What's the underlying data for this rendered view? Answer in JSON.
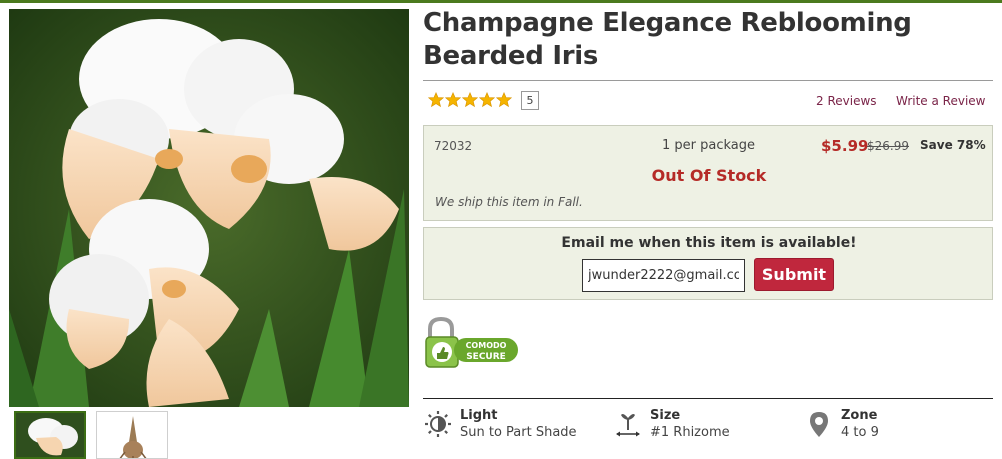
{
  "product": {
    "title": "Champagne Elegance Reblooming Bearded Iris",
    "rating_count": "5",
    "reviews_link": "2 Reviews",
    "write_review": "Write a Review"
  },
  "info": {
    "sku": "72032",
    "package": "1 per package",
    "price": "$5.99",
    "old_price": "$26.99",
    "save": "Save 78%",
    "stock_status": "Out Of Stock",
    "ship_note": "We ship this item in Fall."
  },
  "notify": {
    "title": "Email me when this item is available!",
    "email_value": "jwunder2222@gmail.com",
    "submit_label": "Submit"
  },
  "badge": {
    "line1": "COMODO",
    "line2": "SECURE"
  },
  "attributes": [
    {
      "label": "Light",
      "value": "Sun to Part Shade",
      "icon": "sun-icon"
    },
    {
      "label": "Size",
      "value": "#1 Rhizome",
      "icon": "rhizome-size-icon"
    },
    {
      "label": "Zone",
      "value": "4 to 9",
      "icon": "map-pin-icon"
    }
  ],
  "colors": {
    "accent_red": "#b52b27",
    "button_red": "#c0273d",
    "panel_bg": "#eef1e4",
    "link": "#7a2448",
    "star": "#f5b400"
  }
}
